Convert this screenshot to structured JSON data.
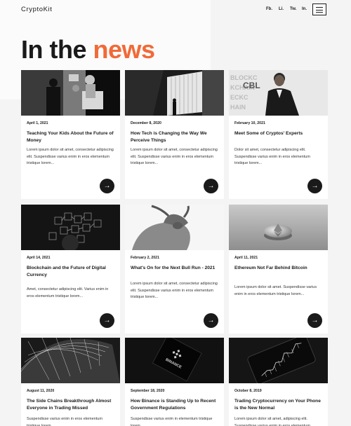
{
  "header": {
    "logo": "CryptoKit",
    "social": [
      "Fb.",
      "Li.",
      "Tw.",
      "In."
    ]
  },
  "hero": {
    "title_part1": "In the",
    "title_part2": "news"
  },
  "colors": {
    "accent": "#f16a38",
    "dark": "#1a1a1a",
    "background": "#f4f4f4"
  },
  "cards": [
    {
      "date": "April 1, 2021",
      "title": "Teaching Your Kids About the Future of Money",
      "excerpt": "Lorem ipsum dolor sit amet, consectetur adipiscing elit. Suspendisse varius enim in eros elementum tristique lorem...",
      "image_icon": "family-photo-icon",
      "arrow": "→"
    },
    {
      "date": "December 8, 2020",
      "title": "How Tech is Changing the Way We Perceive Things",
      "excerpt": "Lorem ipsum dolor sit amet, consectetur adipiscing elit. Suspendisse varius enim in eros elementum tristique lorem...",
      "image_icon": "architecture-photo-icon",
      "arrow": "→"
    },
    {
      "date": "February 10, 2021",
      "title": "Meet Some of Cryptos' Experts",
      "excerpt": "Dolor sit amet, consectetur adipiscing elit. Suspendisse varius enim in eros elementum tristique lorem...",
      "image_icon": "portrait-photo-icon",
      "arrow": "→"
    },
    {
      "date": "April 14, 2021",
      "title": "Blockchain and the Future of Digital Currency",
      "excerpt": "Amet, consectetur adipiscing elit. Varius enim in eros elementum tristique lorem...",
      "image_icon": "blockchain-cubes-icon",
      "arrow": "→"
    },
    {
      "date": "February 2, 2021",
      "title": "What's On for the Next Bull Run - 2021",
      "excerpt": "Lorem ipsum dolor sit amet, consectetur adipiscing elit. Suspendisse varius enim in eros elementum tristique lorem...",
      "image_icon": "bull-statue-icon",
      "arrow": "→"
    },
    {
      "date": "April 11, 2021",
      "title": "Ethereum Not Far Behind Bitcoin",
      "excerpt": "Lorem ipsum dolor sit amet. Suspendisse varius enim in eros elementum tristique lorem...",
      "image_icon": "ethereum-coin-icon",
      "arrow": "→"
    },
    {
      "date": "August 11, 2020",
      "title": "The Side Chains Breakthrough Almost Everyone in Trading Missed",
      "excerpt": "Suspendisse varius enim in eros elementum tristique lorem...",
      "image_icon": "dome-structure-icon",
      "arrow": "→"
    },
    {
      "date": "September 18, 2020",
      "title": "How Binance is Standing Up to Recent Government Regulations",
      "excerpt": "Suspendisse varius enim in elementum tristique lorem...",
      "image_icon": "binance-card-icon",
      "image_text": "BINANCE",
      "arrow": "→"
    },
    {
      "date": "October 8, 2019",
      "title": "Trading Cryptocurrency on Your Phone is the New Normal",
      "excerpt": "Lorem ipsum dolor sit amet, adipiscing elit. Suspendisse varius enim in eros elementum...",
      "image_icon": "phone-chart-icon",
      "arrow": "→"
    }
  ]
}
